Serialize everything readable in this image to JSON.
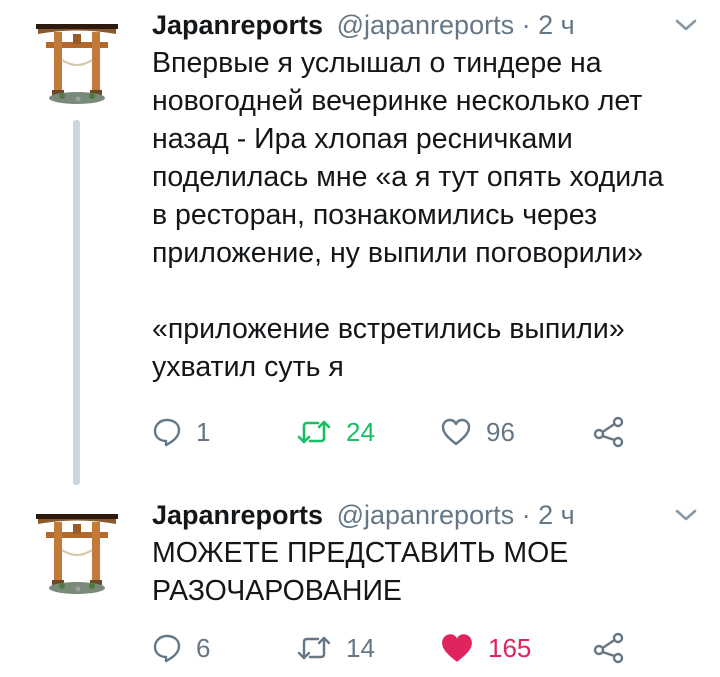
{
  "tweets": [
    {
      "author": "Japanreports",
      "handle": "@japanreports",
      "separator": "·",
      "time": "2 ч",
      "lines": [
        "Впервые я услышал о тиндере на",
        "новогодней вечеринке несколько лет",
        "назад - Ира хлопая ресничками",
        "поделилась мне «а я тут опять ходила",
        "в ресторан, познакомились через",
        "приложение, ну выпили поговорили»",
        "«приложение встретились выпили»",
        "ухватил суть я"
      ],
      "replies": "1",
      "retweets": "24",
      "likes": "96",
      "retweeted": true,
      "liked": false
    },
    {
      "author": "Japanreports",
      "handle": "@japanreports",
      "separator": "·",
      "time": "2 ч",
      "lines": [
        "МОЖЕТЕ ПРЕДСТАВИТЬ МОЕ",
        "РАЗОЧАРОВАНИЕ"
      ],
      "replies": "6",
      "retweets": "14",
      "likes": "165",
      "retweeted": false,
      "liked": true
    }
  ],
  "colors": {
    "text": "#14171a",
    "secondary": "#657786",
    "retweet_active": "#17bf63",
    "like_active": "#e0245e",
    "thread_line": "#cdd6dd"
  },
  "icons": {
    "avatar": "torii-gate-avatar",
    "menu": "chevron-down-icon",
    "reply": "reply-bubble-icon",
    "retweet": "retweet-icon",
    "like": "heart-icon",
    "share": "share-icon"
  }
}
